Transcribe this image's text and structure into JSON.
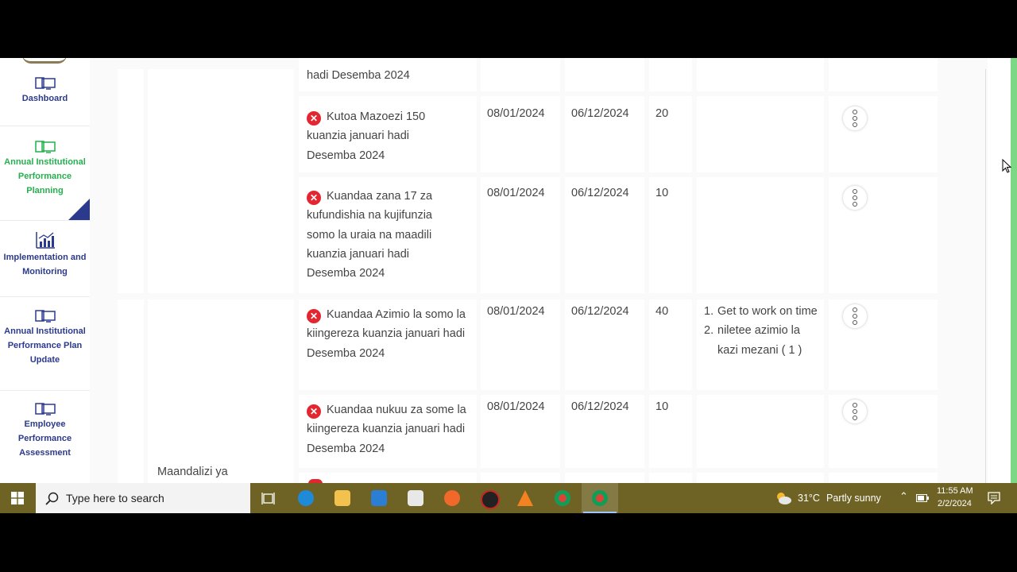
{
  "sidebar": {
    "items": [
      {
        "label": "Dashboard"
      },
      {
        "label": "Annual Institutional Performance Planning"
      },
      {
        "label": "Implementation and Monitoring"
      },
      {
        "label": "Annual Institutional Performance Plan Update"
      },
      {
        "label": "Employee Performance Assessment"
      }
    ]
  },
  "table": {
    "group_label": "Maandalizi ya",
    "rows": [
      {
        "activity": "hadi Desemba 2024"
      },
      {
        "activity": "Kutoa Mazoezi 150 kuanzia januari hadi Desemba 2024",
        "start": "08/01/2024",
        "end": "06/12/2024",
        "value": "20"
      },
      {
        "activity": "Kuandaa zana 17 za kufundishia na kujifunzia somo la uraia na maadili kuanzia januari hadi Desemba 2024",
        "start": "08/01/2024",
        "end": "06/12/2024",
        "value": "10"
      },
      {
        "activity": "Kuandaa Azimio la somo la kiingereza kuanzia januari hadi Desemba 2024",
        "start": "08/01/2024",
        "end": "06/12/2024",
        "value": "40",
        "comments": [
          "Get to work on time",
          "niletee azimio la kazi mezani ( 1 )"
        ]
      },
      {
        "activity": "Kuandaa nukuu za some la kiingereza kuanzia januari hadi Desemba 2024",
        "start": "08/01/2024",
        "end": "06/12/2024",
        "value": "10"
      }
    ]
  },
  "taskbar": {
    "search_placeholder": "Type here to search",
    "weather_temp": "31°C",
    "weather_desc": "Partly sunny",
    "time": "11:55 AM",
    "date": "2/2/2024"
  },
  "colors": {
    "nav_text": "#2b3a8c",
    "nav_active": "#22b14c",
    "error_icon": "#e3262f",
    "taskbar": "#6e6325"
  },
  "icons": {
    "status": "close-circle-icon",
    "row_menu": "vertical-dots-icon",
    "nav": [
      "monitor-icon",
      "monitor-icon",
      "bar-chart-icon",
      "monitor-icon",
      "monitor-icon"
    ]
  }
}
